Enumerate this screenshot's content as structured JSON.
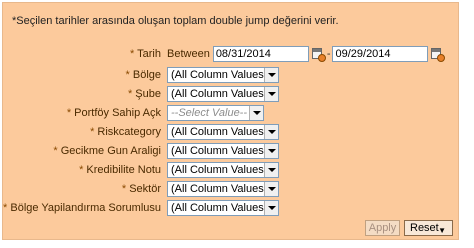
{
  "description": "*Seçilen tarihler arasında oluşan toplam double jump değerini verir.",
  "date_filter": {
    "label": "Tarih",
    "between_label": "Between",
    "start_value": "08/31/2014",
    "separator": "-",
    "end_value": "09/29/2014"
  },
  "filters": [
    {
      "label": "Bölge",
      "value": "(All Column Values)",
      "placeholder": false
    },
    {
      "label": "Şube",
      "value": "(All Column Values)",
      "placeholder": false
    },
    {
      "label": "Portföy Sahip Açk",
      "value": "--Select Value--",
      "placeholder": true
    },
    {
      "label": "Riskcategory",
      "value": "(All Column Values)",
      "placeholder": false
    },
    {
      "label": "Gecikme Gun Araligi",
      "value": "(All Column Values)",
      "placeholder": false
    },
    {
      "label": "Kredibilite Notu",
      "value": "(All Column Values)",
      "placeholder": false
    },
    {
      "label": "Sektör",
      "value": "(All Column Values)",
      "placeholder": false
    },
    {
      "label": "Bölge Yapilandırma Sorumlusu",
      "value": "(All Column Values)",
      "placeholder": false
    }
  ],
  "required_marker": "*",
  "buttons": {
    "apply": "Apply",
    "reset": "Reset",
    "reset_icon": "chevron-down-icon"
  },
  "colors": {
    "panel_bg": "#fcca9c",
    "label_text": "#4a2a00"
  }
}
